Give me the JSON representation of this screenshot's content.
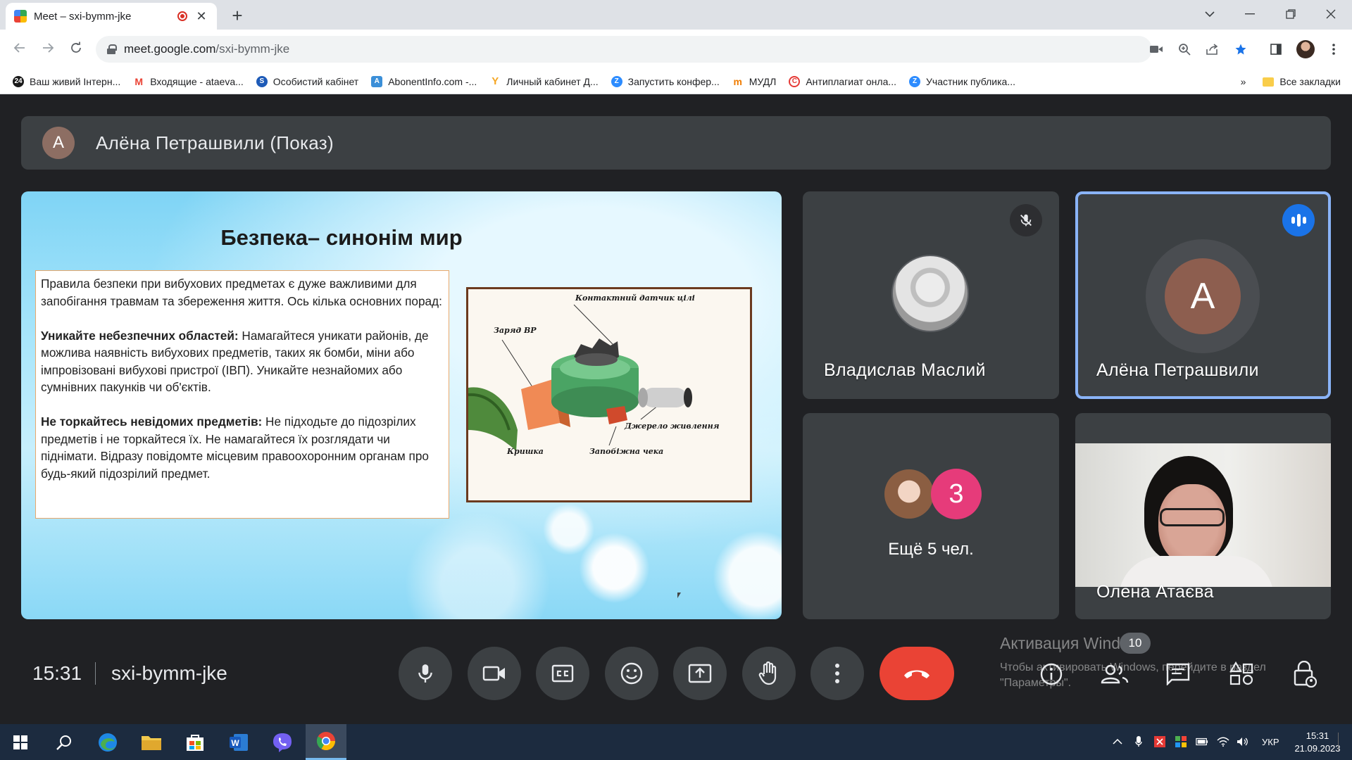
{
  "browser": {
    "tab_title": "Meet – sxi-bymm-jke",
    "url_host": "meet.google.com",
    "url_path": "/sxi-bymm-jke",
    "bookmarks": [
      {
        "label": "Ваш живий Інтерн...",
        "color": "#1a1a1a",
        "glyph": "24"
      },
      {
        "label": "Входящие - ataeva...",
        "color": "#ea4335",
        "glyph": "M"
      },
      {
        "label": "Особистий кабінет",
        "color": "#1e5bb8",
        "glyph": "S"
      },
      {
        "label": "AbonentInfo.com -...",
        "color": "#3b8fd8",
        "glyph": "A"
      },
      {
        "label": "Личный кабинет Д...",
        "color": "#f5a623",
        "glyph": "Y"
      },
      {
        "label": "Запустить конфер...",
        "color": "#2d8cff",
        "glyph": "Z"
      },
      {
        "label": "МУДЛ",
        "color": "#f07c00",
        "glyph": "m"
      },
      {
        "label": "Антиплагиат онла...",
        "color": "#e53935",
        "glyph": "C"
      },
      {
        "label": "Участник публика...",
        "color": "#2d8cff",
        "glyph": "Z"
      }
    ],
    "more_bookmarks": "»",
    "all_bookmarks_label": "Все закладки"
  },
  "meet": {
    "presenter_initial": "А",
    "presenter_label": "Алёна Петрашвили (Показ)",
    "slide": {
      "title": "Безпека– синонім мир",
      "intro": "Правила безпеки при вибухових предметах є дуже важливими для запобігання травмам та збереження життя. Ось кілька основних порад:",
      "point1_bold": "Уникайте небезпечних областей:",
      "point1_text": " Намагайтеся уникати районів, де можлива наявність вибухових предметів, таких як бомби, міни або імпровізовані вибухові пристрої (ІВП). Уникайте незнайомих або сумнівних пакунків чи об'єктів.",
      "point2_bold": "Не торкайтесь невідомих предметів:",
      "point2_text": " Не підходьте до підозрілих предметів і не торкайтеся їх. Не намагайтеся їх розглядати чи піднімати. Відразу повідомте місцевим правоохоронним органам про будь-який підозрілий предмет.",
      "figure_labels": {
        "sensor": "Контактний датчик цілі",
        "charge": "Заряд ВР",
        "power": "Джерело живлення",
        "lid": "Кришка",
        "pin": "Запобіжна чека"
      }
    },
    "participants": [
      {
        "name": "Владислав Маслий",
        "muted": true
      },
      {
        "name": "Алёна Петрашвили",
        "initial": "А",
        "speaking": true
      },
      {
        "more_count": "3",
        "more_label": "Ещё 5 чел."
      },
      {
        "name": "Олена Атаєва"
      }
    ],
    "time": "15:31",
    "meeting_code": "sxi-bymm-jke",
    "people_count": "10",
    "watermark_title": "Активация Windows",
    "watermark_line1": "Чтобы активировать Windows, перейдите в раздел",
    "watermark_line2": "\"Параметры\"."
  },
  "taskbar": {
    "lang": "УКР",
    "time": "15:31",
    "date": "21.09.2023"
  }
}
